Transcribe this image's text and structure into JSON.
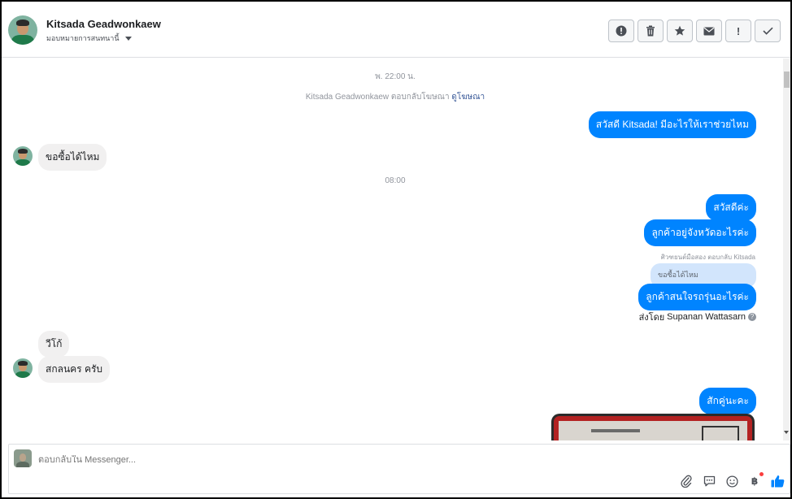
{
  "header": {
    "name": "Kitsada Geadwonkaew",
    "assign_label": "มอบหมายการสนทนานี้"
  },
  "toolbar": {
    "buttons": [
      {
        "icon": "alert-circle-icon",
        "glyph": "!"
      },
      {
        "icon": "trash-icon"
      },
      {
        "icon": "star-icon"
      },
      {
        "icon": "envelope-icon"
      },
      {
        "icon": "exclamation-icon",
        "glyph": "!"
      },
      {
        "icon": "check-icon"
      }
    ]
  },
  "conversation": {
    "timestamp_1": "พ. 22:00 น.",
    "ad_reply": {
      "text": "Kitsada Geadwonkaew ตอบกลับโฆษณา",
      "link": "ดูโฆษณา"
    },
    "msg_out_1": "สวัสดี Kitsada! มีอะไรให้เราช่วยไหม",
    "msg_in_1": "ขอซื้อได้ไหม",
    "timestamp_2": "08:00",
    "msg_out_2": "สวัสดีค่ะ",
    "msg_out_3": "ลูกค้าอยู่จังหวัดอะไรค่ะ",
    "replied_note": "ศิวฑยนต์มือสอง ตอบกลับ Kitsada",
    "quoted_text": "ขอซื้อได้ไหม",
    "msg_out_4": "ลูกค้าสนใจรถรุ่นอะไรค่ะ",
    "sent_by_label": "ส่งโดย",
    "sent_by_name": "Supanan Wattasarn",
    "sent_by_help": "?",
    "msg_in_2": "วีโก้",
    "msg_in_3": "สกลนคร ครับ",
    "msg_out_5": "สักคู่นะคะ"
  },
  "composer": {
    "placeholder": "ตอบกลับใน Messenger...",
    "baht_symbol": "฿"
  },
  "colors": {
    "outgoing_bubble": "#0084ff",
    "incoming_bubble": "#f1f0f0",
    "quote_bubble": "#d2e5fc",
    "link": "#385898",
    "like": "#0084ff"
  }
}
